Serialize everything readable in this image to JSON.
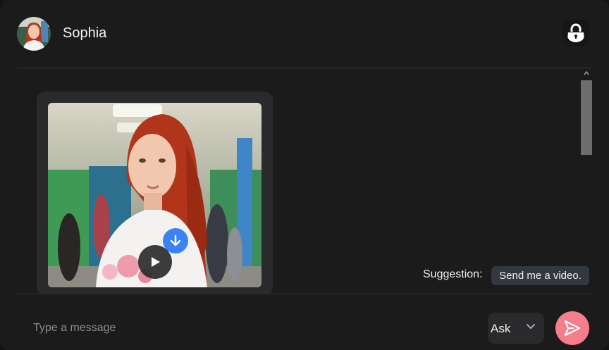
{
  "header": {
    "contact_name": "Sophia",
    "avatar_icon": "profile-photo",
    "lock_icon": "lock-icon"
  },
  "message": {
    "type": "video-thumbnail",
    "download_icon": "arrow-down-icon",
    "play_icon": "play-icon"
  },
  "suggestion": {
    "label": "Suggestion:",
    "text": "Send me a video."
  },
  "composer": {
    "placeholder": "Type a message",
    "mode": "Ask",
    "send_icon": "send-icon"
  },
  "colors": {
    "background": "#1b1b1c",
    "card": "#2a2a2c",
    "download_accent": "#3b82f6",
    "send_accent": "#f47f8b"
  }
}
